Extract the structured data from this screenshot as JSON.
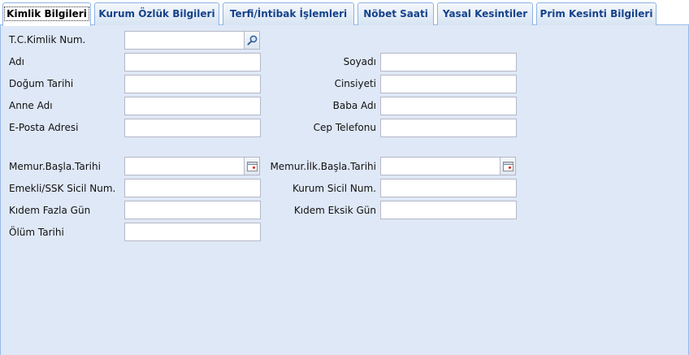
{
  "tabs": [
    {
      "label": "Kimlik Bilgileri",
      "active": true
    },
    {
      "label": "Kurum Özlük Bilgileri"
    },
    {
      "label": "Terfi/İntibak İşlemleri"
    },
    {
      "label": "Nöbet Saati"
    },
    {
      "label": "Yasal Kesintiler"
    },
    {
      "label": "Prim Kesinti Bilgileri"
    }
  ],
  "form": {
    "tc_label": "T.C.Kimlik Num.",
    "adi_label": "Adı",
    "soyadi_label": "Soyadı",
    "dogum_label": "Doğum Tarihi",
    "cinsiyet_label": "Cinsiyeti",
    "anne_label": "Anne Adı",
    "baba_label": "Baba Adı",
    "eposta_label": "E-Posta Adresi",
    "cep_label": "Cep Telefonu",
    "memur_basla_label": "Memur.Başla.Tarihi",
    "memur_ilk_label": "Memur.İlk.Başla.Tarihi",
    "emekli_label": "Emekli/SSK Sicil Num.",
    "kurum_sicil_label": "Kurum Sicil Num.",
    "kidem_fazla_label": "Kıdem Fazla Gün",
    "kidem_eksik_label": "Kıdem Eksik Gün",
    "olum_label": "Ölüm Tarihi"
  },
  "colors": {
    "panel_bg": "#dfe8f6",
    "tab_text": "#15428b",
    "border": "#99bbe8"
  },
  "icons": {
    "search": "search-icon",
    "calendar": "calendar-icon"
  }
}
